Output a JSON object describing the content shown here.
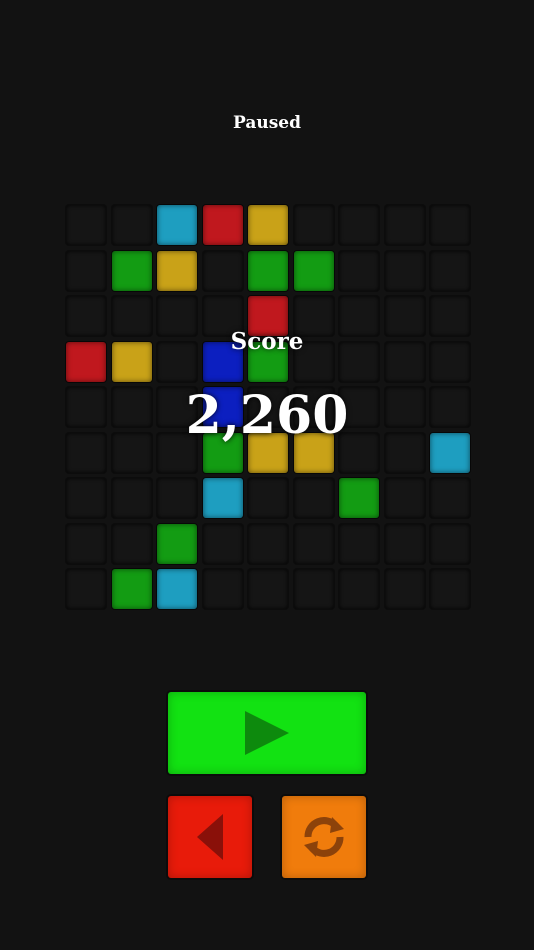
{
  "status": "Paused",
  "score": {
    "label": "Score",
    "value": "2,260"
  },
  "colors": {
    "background": "#121212",
    "empty": "#151515",
    "cyan": "#1e9ec0",
    "red": "#c0181e",
    "yellow": "#c9a218",
    "green": "#139c13",
    "blue": "#0c1fc0",
    "play_button": "#12e212",
    "play_icon": "#0d8a0d",
    "back_button": "#e81b0a",
    "back_icon": "#8a1009",
    "restart_button": "#f07c0c",
    "restart_icon": "#8c420a"
  },
  "board": {
    "rows": 9,
    "cols": 9,
    "cells": [
      [
        "",
        "",
        "cyan",
        "red",
        "yellow",
        "",
        "",
        "",
        ""
      ],
      [
        "",
        "green",
        "yellow",
        "",
        "green",
        "green",
        "",
        "",
        ""
      ],
      [
        "",
        "",
        "",
        "",
        "red",
        "",
        "",
        "",
        ""
      ],
      [
        "red",
        "yellow",
        "",
        "blue",
        "green",
        "",
        "",
        "",
        ""
      ],
      [
        "",
        "",
        "",
        "blue",
        "",
        "",
        "",
        "",
        ""
      ],
      [
        "",
        "",
        "",
        "green",
        "yellow",
        "yellow",
        "",
        "",
        "cyan"
      ],
      [
        "",
        "",
        "",
        "cyan",
        "",
        "",
        "green",
        "",
        ""
      ],
      [
        "",
        "",
        "green",
        "",
        "",
        "",
        "",
        "",
        ""
      ],
      [
        "",
        "green",
        "cyan",
        "",
        "",
        "",
        "",
        "",
        ""
      ]
    ]
  },
  "controls": {
    "play": {
      "icon": "play-icon"
    },
    "back": {
      "icon": "back-arrow-icon"
    },
    "restart": {
      "icon": "restart-icon"
    }
  }
}
